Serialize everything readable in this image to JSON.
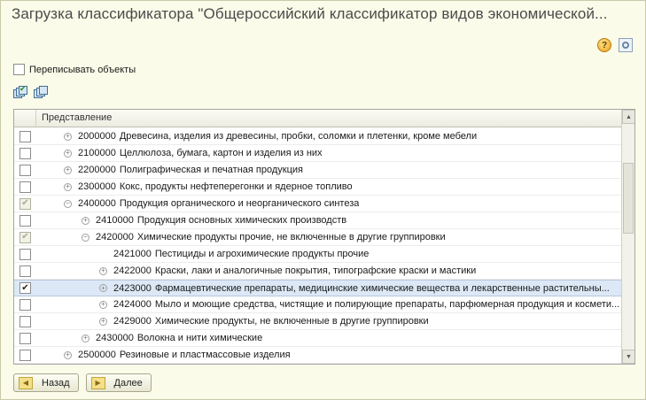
{
  "window": {
    "title": "Загрузка классификатора \"Общероссийский классификатор видов экономической..."
  },
  "top_icons": {
    "help_icon": "help-icon",
    "help_glyph": "?",
    "settings_icon": "settings-icon"
  },
  "rewrite_checkbox": {
    "label": "Переписывать объекты",
    "checked": false
  },
  "mini_toolbar": {
    "check_all_icon": "check-all-icon",
    "uncheck_all_icon": "uncheck-all-icon"
  },
  "grid": {
    "column_header": "Представление",
    "rows": [
      {
        "code": "2000000",
        "name": "Древесина, изделия из древесины, пробки, соломки и плетенки, кроме мебели",
        "level": 1,
        "expander": "+",
        "check": "unchecked",
        "selected": false
      },
      {
        "code": "2100000",
        "name": "Целлюлоза, бумага, картон и изделия из них",
        "level": 1,
        "expander": "+",
        "check": "unchecked",
        "selected": false
      },
      {
        "code": "2200000",
        "name": "Полиграфическая и печатная продукция",
        "level": 1,
        "expander": "+",
        "check": "unchecked",
        "selected": false
      },
      {
        "code": "2300000",
        "name": "Кокс, продукты нефтеперегонки и ядерное топливо",
        "level": 1,
        "expander": "+",
        "check": "unchecked",
        "selected": false
      },
      {
        "code": "2400000",
        "name": "Продукция органического и неорганического синтеза",
        "level": 1,
        "expander": "−",
        "check": "partial",
        "selected": false
      },
      {
        "code": "2410000",
        "name": "Продукция основных химических производств",
        "level": 2,
        "expander": "+",
        "check": "unchecked",
        "selected": false
      },
      {
        "code": "2420000",
        "name": "Химические продукты прочие, не включенные в другие группировки",
        "level": 2,
        "expander": "−",
        "check": "partial",
        "selected": false
      },
      {
        "code": "2421000",
        "name": "Пестициды и агрохимические продукты прочие",
        "level": 3,
        "expander": "",
        "check": "unchecked",
        "selected": false
      },
      {
        "code": "2422000",
        "name": "Краски, лаки и аналогичные покрытия, типографские краски и мастики",
        "level": 3,
        "expander": "+",
        "check": "unchecked",
        "selected": false
      },
      {
        "code": "2423000",
        "name": "Фармацевтические препараты, медицинские химические вещества и лекарственные растительны...",
        "level": 3,
        "expander": "+",
        "check": "checked",
        "selected": true
      },
      {
        "code": "2424000",
        "name": "Мыло и моющие средства, чистящие и полирующие препараты, парфюмерная продукция и космети...",
        "level": 3,
        "expander": "+",
        "check": "unchecked",
        "selected": false
      },
      {
        "code": "2429000",
        "name": "Химические продукты, не включенные в другие группировки",
        "level": 3,
        "expander": "+",
        "check": "unchecked",
        "selected": false
      },
      {
        "code": "2430000",
        "name": "Волокна и нити химические",
        "level": 2,
        "expander": "+",
        "check": "unchecked",
        "selected": false
      },
      {
        "code": "2500000",
        "name": "Резиновые и пластмассовые изделия",
        "level": 1,
        "expander": "+",
        "check": "unchecked",
        "selected": false
      }
    ]
  },
  "buttons": {
    "back": "Назад",
    "next": "Далее"
  },
  "colors": {
    "background": "#fbfbe9",
    "selected_row": "#dce8f6",
    "title_text": "#4b4b4b"
  }
}
